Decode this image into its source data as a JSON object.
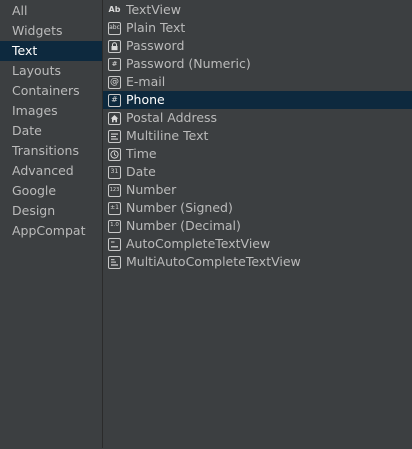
{
  "categories": [
    {
      "label": "All"
    },
    {
      "label": "Widgets"
    },
    {
      "label": "Text"
    },
    {
      "label": "Layouts"
    },
    {
      "label": "Containers"
    },
    {
      "label": "Images"
    },
    {
      "label": "Date"
    },
    {
      "label": "Transitions"
    },
    {
      "label": "Advanced"
    },
    {
      "label": "Google"
    },
    {
      "label": "Design"
    },
    {
      "label": "AppCompat"
    }
  ],
  "selected_category": "Text",
  "widgets": [
    {
      "label": "TextView",
      "icon": "textview-icon",
      "glyph": "Ab"
    },
    {
      "label": "Plain Text",
      "icon": "plain-text-icon",
      "glyph": "abc"
    },
    {
      "label": "Password",
      "icon": "password-lock-icon",
      "glyph": ""
    },
    {
      "label": "Password (Numeric)",
      "icon": "password-numeric-icon",
      "glyph": "#"
    },
    {
      "label": "E-mail",
      "icon": "email-at-icon",
      "glyph": "@"
    },
    {
      "label": "Phone",
      "icon": "phone-hash-icon",
      "glyph": "#"
    },
    {
      "label": "Postal Address",
      "icon": "postal-address-house-icon",
      "glyph": ""
    },
    {
      "label": "Multiline Text",
      "icon": "multiline-text-icon",
      "glyph": ""
    },
    {
      "label": "Time",
      "icon": "time-clock-icon",
      "glyph": ""
    },
    {
      "label": "Date",
      "icon": "date-calendar-icon",
      "glyph": "31"
    },
    {
      "label": "Number",
      "icon": "number-icon",
      "glyph": "123"
    },
    {
      "label": "Number (Signed)",
      "icon": "number-signed-icon",
      "glyph": "±1"
    },
    {
      "label": "Number (Decimal)",
      "icon": "number-decimal-icon",
      "glyph": "1.0"
    },
    {
      "label": "AutoCompleteTextView",
      "icon": "autocomplete-icon",
      "glyph": ""
    },
    {
      "label": "MultiAutoCompleteTextView",
      "icon": "multi-autocomplete-icon",
      "glyph": ""
    }
  ],
  "selected_widget": "Phone",
  "colors": {
    "background": "#3c3f41",
    "selection": "#0d293e",
    "text": "#bbbbbb"
  }
}
